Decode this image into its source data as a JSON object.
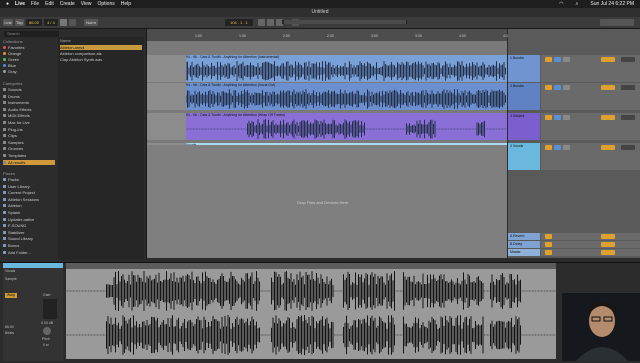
{
  "menubar": {
    "app": "Live",
    "items": [
      "File",
      "Edit",
      "Create",
      "View",
      "Options",
      "Help"
    ],
    "clock": "Sun Jul 24  6:22 PM"
  },
  "window_title": "Untitled",
  "transport": {
    "link": "Link",
    "tap": "Tap",
    "tempo": "86.00",
    "signature": "4 / 4",
    "quantize": "Norm",
    "quantize_value": "1 Bar",
    "position": "104 . 1 . 1"
  },
  "browser": {
    "search_placeholder": "Search",
    "collections_label": "Collections",
    "collections": [
      {
        "label": "Favorites",
        "color": "#e05050"
      },
      {
        "label": "Orange",
        "color": "#e8903a"
      },
      {
        "label": "Green",
        "color": "#5bbf5b"
      },
      {
        "label": "Blue",
        "color": "#4a8ee0"
      },
      {
        "label": "Gray",
        "color": "#9a9a9a"
      }
    ],
    "categories_label": "Categories",
    "categories": [
      "Sounds",
      "Drums",
      "Instruments",
      "Audio Effects",
      "MIDI Effects",
      "Max for Live",
      "Plug-Ins",
      "Clips",
      "Samples",
      "Grooves",
      "Templates",
      "All results"
    ],
    "places_label": "Places",
    "places": [
      "Packs",
      "User Library",
      "Current Project",
      "Ableton Sessions",
      "Ableton",
      "Splash",
      "Updater-native",
      "F-SOUND",
      "Stabilizer",
      "Sound Library",
      "Bonus",
      "Add Folder..."
    ],
    "files_header": "Name",
    "files": [
      "Ableton.ams4",
      "Ableton comparison.als",
      "Clap Ableton Synth.wav"
    ]
  },
  "tracks": [
    {
      "name": "1 Brooks",
      "clip": "94 - 96 - Cats & Toolkt - Anything for Attention (Instrumental)",
      "color": "#7aa0d8",
      "head": "#6f94cf"
    },
    {
      "name": "2 Brooks",
      "clip": "94 - 96 - Cats & Toolkt - Anything for Attention (Vocal Out)",
      "color": "#6b8fcf",
      "head": "#5f82c2"
    },
    {
      "name": "3 Sibilant",
      "clip": "94 - 96 - Cats & Toolkt - Anything for Attention (Wrap Off Tracks)",
      "color": "#8a6fd6",
      "head": "#7c5fce"
    },
    {
      "name": "4 Vocals",
      "clip": "Vocals",
      "color": "#a9dbf0",
      "head": "#6ab8de"
    }
  ],
  "returns": [
    "A Reverb",
    "B Delay",
    "Master"
  ],
  "arrangement": {
    "drop_hint": "Drop Files and Devices Here",
    "ruler_marks": [
      "1:00",
      "1:30",
      "2:00",
      "2:30",
      "3:00",
      "3:30",
      "4:00",
      "4:30"
    ]
  },
  "detail": {
    "clip_name": "Vocals",
    "sample_label": "Sample",
    "gain_label": "Gain",
    "gain_value": "0.00 dB",
    "warp_label": "Warp",
    "bpm_value": "86.00",
    "pitch_label": "Pitch",
    "pitch_value": "0 st",
    "mode": "Beats"
  },
  "colors": {
    "accent_orange": "#d09a3a",
    "selected_clip": "#a9dbf0",
    "purple_clip": "#8a6fd6"
  }
}
